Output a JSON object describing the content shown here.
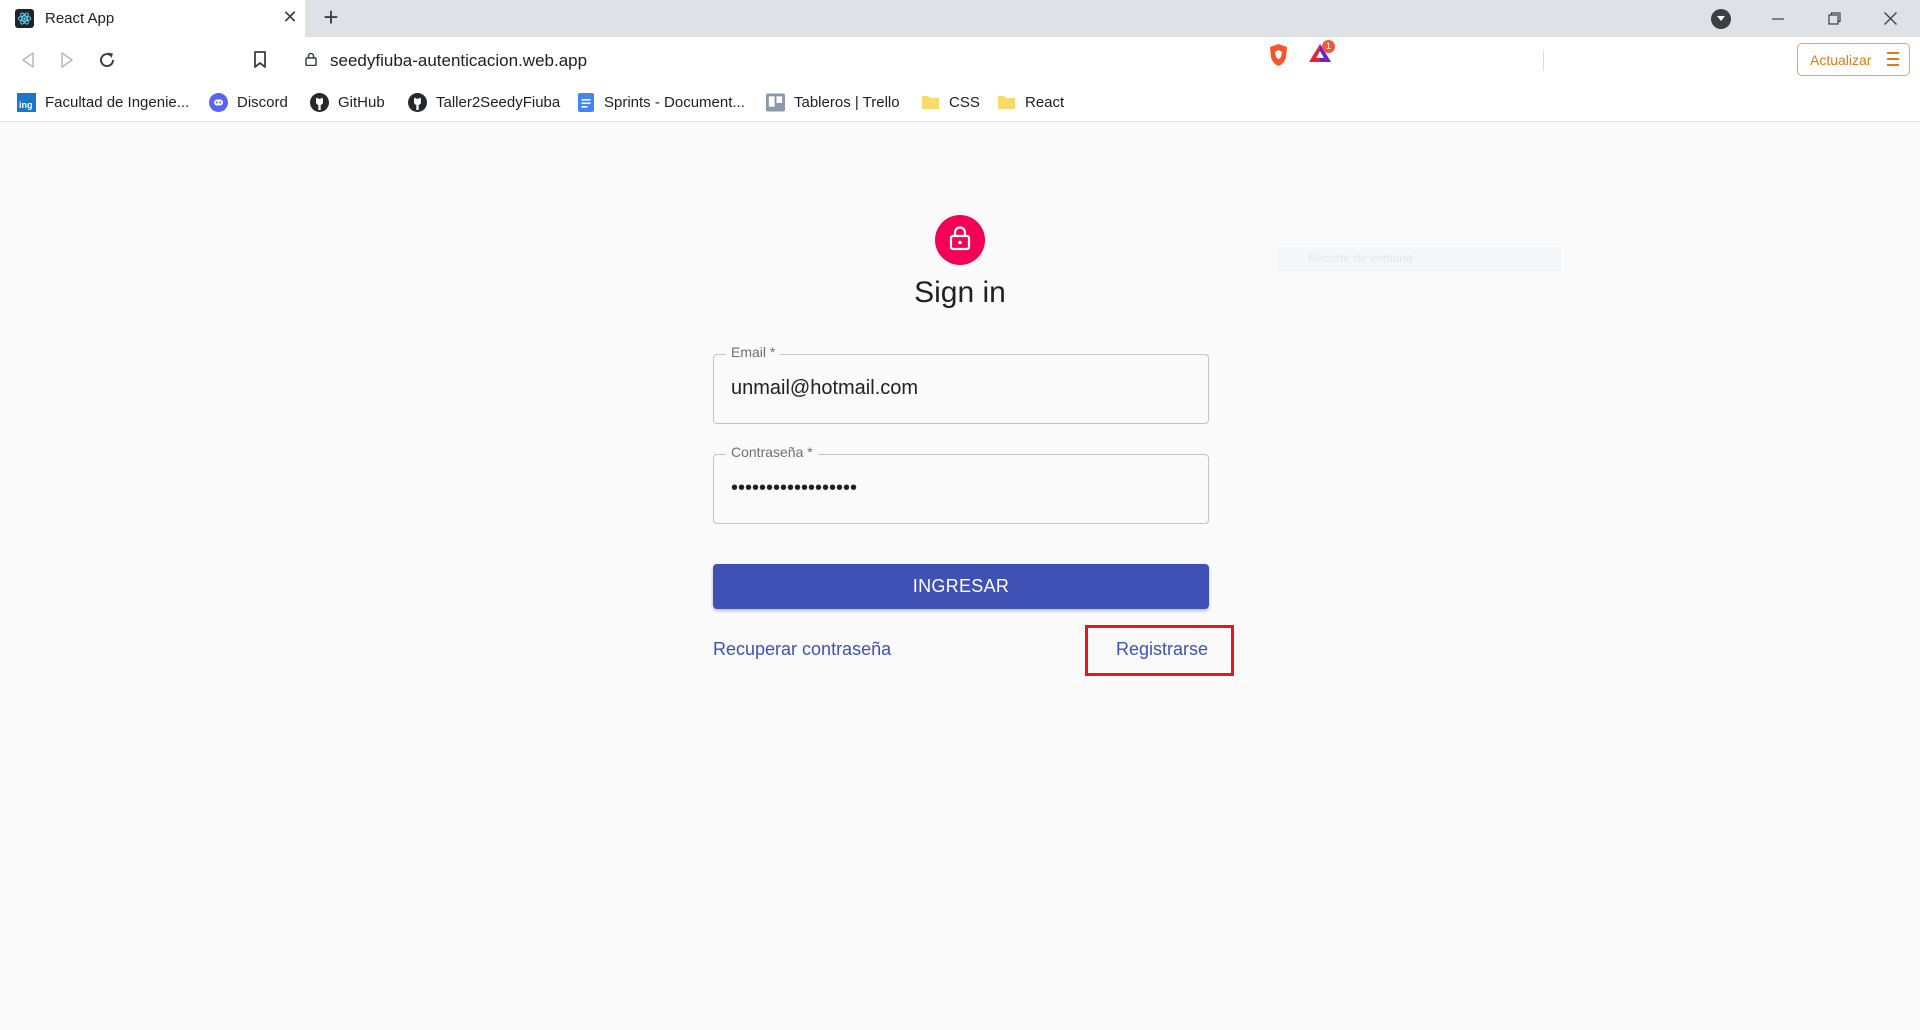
{
  "tab": {
    "title": "React App",
    "close": "✕"
  },
  "new_tab": "+",
  "toolbar": {
    "url": "seedyfiuba-autenticacion.web.app",
    "rewards_badge": "1",
    "update_label": "Actualizar"
  },
  "bookmarks": [
    {
      "label": "Facultad de Ingenie...",
      "icon": "fiuba-ing-icon"
    },
    {
      "label": "Discord",
      "icon": "discord-icon"
    },
    {
      "label": "GitHub",
      "icon": "github-icon"
    },
    {
      "label": "Taller2SeedyFiuba",
      "icon": "github-icon"
    },
    {
      "label": "Sprints - Document...",
      "icon": "google-docs-icon"
    },
    {
      "label": "Tableros | Trello",
      "icon": "trello-icon"
    },
    {
      "label": "CSS",
      "icon": "folder-icon"
    },
    {
      "label": "React",
      "icon": "folder-icon"
    }
  ],
  "form": {
    "title": "Sign in",
    "email_label": "Email *",
    "email_value": "unmail@hotmail.com",
    "password_label": "Contraseña *",
    "password_value": "••••••••••••••••••",
    "submit_label": "INGRESAR",
    "recover_link": "Recuperar contraseña",
    "register_link": "Registrarse"
  },
  "ghost_text": "Recorte de ventana",
  "colors": {
    "primary": "#3f51b5",
    "avatar": "#f50057",
    "highlight": "#e8141e",
    "update_accent": "#e07b18"
  }
}
